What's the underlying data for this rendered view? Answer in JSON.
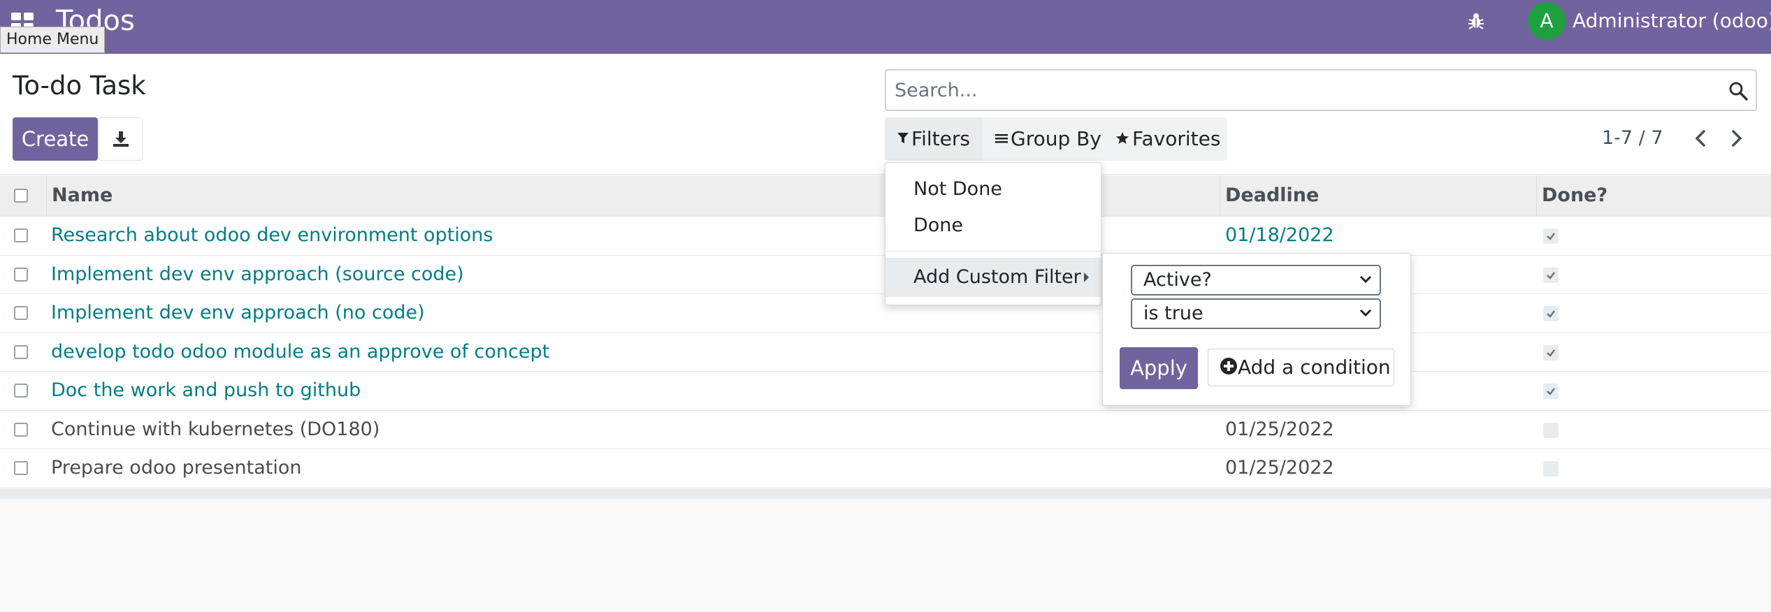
{
  "navbar": {
    "app_title": "Todos",
    "user_initial": "A",
    "user_name": "Administrator (odoo)",
    "tooltip": "Home Menu"
  },
  "control_panel": {
    "page_title": "To-do Task",
    "create_label": "Create",
    "search_placeholder": "Search...",
    "filters_label": "Filters",
    "groupby_label": "Group By",
    "favorites_label": "Favorites",
    "pager_value": "1-7 / 7"
  },
  "table": {
    "columns": {
      "name": "Name",
      "deadline": "Deadline",
      "done": "Done?"
    },
    "rows": [
      {
        "name": "Research about odoo dev environment options",
        "deadline": "01/18/2022",
        "done": true,
        "link": true
      },
      {
        "name": "Implement dev env approach (source code)",
        "deadline": "",
        "done": true,
        "link": true
      },
      {
        "name": "Implement dev env approach (no code)",
        "deadline": "",
        "done": true,
        "link": true
      },
      {
        "name": "develop todo odoo module as an approve of concept",
        "deadline": "",
        "done": true,
        "link": true
      },
      {
        "name": "Doc the work and push to github",
        "deadline": "",
        "done": true,
        "link": true
      },
      {
        "name": "Continue with kubernetes (DO180)",
        "deadline": "01/25/2022",
        "done": false,
        "link": false
      },
      {
        "name": "Prepare odoo presentation",
        "deadline": "01/25/2022",
        "done": false,
        "link": false
      }
    ]
  },
  "filters_dropdown": {
    "items": [
      "Not Done",
      "Done"
    ],
    "custom_filter_label": "Add Custom Filter"
  },
  "custom_filter": {
    "field_value": "Active?",
    "operator_value": "is true",
    "apply_label": "Apply",
    "add_condition_label": "Add a condition"
  },
  "colors": {
    "brand": "#71639e",
    "link": "#017e84",
    "avatar": "#1fa13f"
  }
}
